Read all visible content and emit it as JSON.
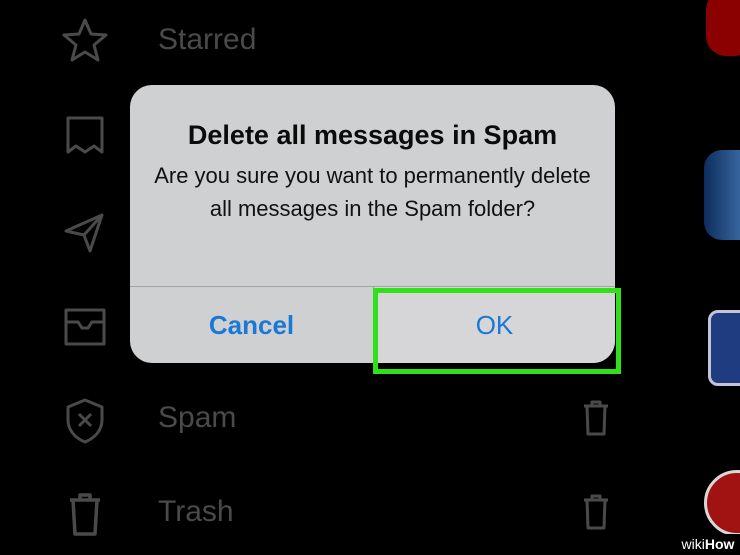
{
  "menu": {
    "items": [
      {
        "label": "Starred",
        "icon": "star-icon"
      },
      {
        "label": "",
        "icon": "important-icon"
      },
      {
        "label": "",
        "icon": "sent-icon"
      },
      {
        "label": "",
        "icon": "inbox-tray-icon"
      },
      {
        "label": "Spam",
        "icon": "spam-shield-icon"
      },
      {
        "label": "Trash",
        "icon": "trash-icon"
      }
    ]
  },
  "alert": {
    "title": "Delete all messages in Spam",
    "message": "Are you sure you want to permanently delete all messages in the Spam folder?",
    "cancel_label": "Cancel",
    "ok_label": "OK"
  },
  "watermark": {
    "prefix": "wiki",
    "suffix": "How"
  },
  "colors": {
    "background": "#000000",
    "dialog": "#cfd0d2",
    "button_text": "#1a78d6",
    "highlight": "#2fe01b"
  }
}
